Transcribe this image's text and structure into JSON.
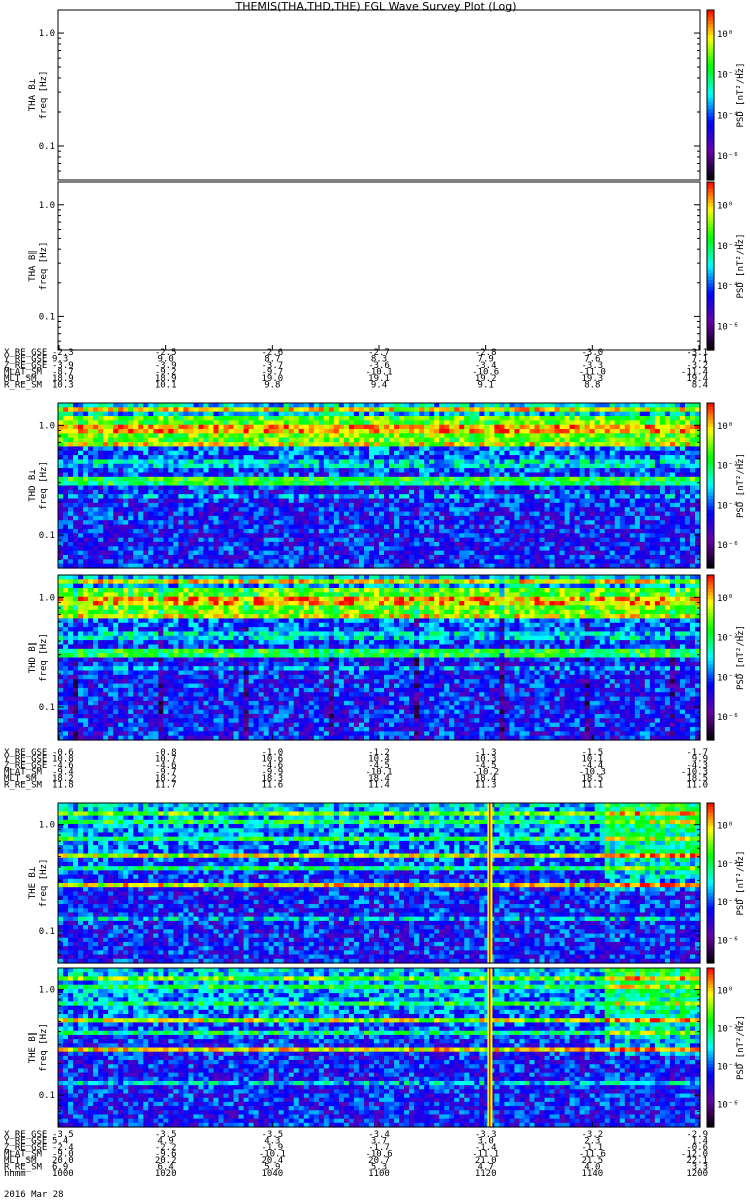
{
  "title": "THEMIS(THA,THD,THE) FGL Wave Survey Plot (Log)",
  "date_label": "2016 Mar 28",
  "chart_data": {
    "type": "heatmap",
    "yscale": "log",
    "ylim": [
      0.05,
      1.6
    ],
    "ytick_labels": [
      "1.0",
      "0.1"
    ],
    "ylabel_unit": "freq [Hz]",
    "colorbar_label": "PSD [nT²/Hz]",
    "colorbar_ticks": [
      "10⁰",
      "10⁻²",
      "10⁻⁴",
      "10⁻⁶"
    ],
    "colorscale": [
      "#000000",
      "#6a00a8",
      "#0000ff",
      "#00ffff",
      "#00ff00",
      "#ffff00",
      "#ff0000"
    ],
    "groups": [
      {
        "panels": [
          {
            "label": "THA B⊥",
            "data": "none"
          },
          {
            "label": "THA B∥",
            "data": "none"
          }
        ],
        "ephemeris": [
          {
            "name": "X_RE_GSE",
            "values": [
              "-2.3",
              "-2.5",
              "-2.6",
              "-2.7",
              "-2.8",
              "-3.0",
              "-3.1"
            ]
          },
          {
            "name": "Y_RE_GSE",
            "values": [
              "9.3",
              "9.0",
              "8.7",
              "8.3",
              "7.9",
              "7.6",
              "7.1"
            ]
          },
          {
            "name": "Z_RE_GSE",
            "values": [
              "-3.9",
              "-3.9",
              "-3.7",
              "-3.6",
              "-3.4",
              "-3.3",
              "-3.2"
            ]
          },
          {
            "name": "MLAT_SM",
            "values": [
              "-8.7",
              "-9.2",
              "-9.7",
              "-10.1",
              "-10.6",
              "-11.0",
              "-11.4"
            ]
          },
          {
            "name": "MLT_SM",
            "values": [
              "18.9",
              "18.9",
              "19.0",
              "19.1",
              "19.2",
              "19.3",
              "19.4"
            ]
          },
          {
            "name": "R_RE_SM",
            "values": [
              "10.3",
              "10.1",
              "9.8",
              "9.4",
              "9.1",
              "8.8",
              "8.4"
            ]
          }
        ]
      },
      {
        "panels": [
          {
            "label": "THD B⊥",
            "data": "spectrogram"
          },
          {
            "label": "THD B∥",
            "data": "spectrogram"
          }
        ],
        "ephemeris": [
          {
            "name": "X_RE_GSE",
            "values": [
              "-0.6",
              "-0.8",
              "-1.0",
              "-1.2",
              "-1.3",
              "-1.5",
              "-1.7"
            ]
          },
          {
            "name": "Y_RE_GSE",
            "values": [
              "10.8",
              "10.7",
              "10.6",
              "10.4",
              "10.3",
              "10.1",
              "9.9"
            ]
          },
          {
            "name": "Z_RE_GSE",
            "values": [
              "-4.6",
              "-4.6",
              "-4.6",
              "-4.5",
              "-4.5",
              "-4.4",
              "-4.3"
            ]
          },
          {
            "name": "MLAT_SM",
            "values": [
              "-9.4",
              "-9.7",
              "-9.9",
              "-10.1",
              "-10.2",
              "-10.3",
              "-10.3"
            ]
          },
          {
            "name": "MLT_SM",
            "values": [
              "18.2",
              "18.2",
              "18.3",
              "18.4",
              "18.4",
              "18.5",
              "18.5"
            ]
          },
          {
            "name": "R_RE_SM",
            "values": [
              "11.8",
              "11.7",
              "11.6",
              "11.4",
              "11.3",
              "11.1",
              "11.0"
            ]
          }
        ]
      },
      {
        "panels": [
          {
            "label": "THE B⊥",
            "data": "spectrogram"
          },
          {
            "label": "THE B∥",
            "data": "spectrogram"
          }
        ],
        "ephemeris": [
          {
            "name": "X_RE_GSE",
            "values": [
              "-3.5",
              "-3.5",
              "-3.5",
              "-3.4",
              "-3.3",
              "-3.2",
              "-2.9"
            ]
          },
          {
            "name": "Y_RE_GSE",
            "values": [
              "5.4",
              "4.9",
              "4.3",
              "3.7",
              "3.0",
              "2.3",
              "1.4"
            ]
          },
          {
            "name": "Z_RE_GSE",
            "values": [
              "-2.4",
              "-2.2",
              "-1.9",
              "-1.7",
              "-1.4",
              "-1.1",
              "-0.6"
            ]
          },
          {
            "name": "MLAT_SM",
            "values": [
              "-9.0",
              "-9.6",
              "-10.1",
              "-10.6",
              "-11.1",
              "-11.6",
              "-12.0"
            ]
          },
          {
            "name": "MLT_SM",
            "values": [
              "20.0",
              "20.2",
              "20.4",
              "20.7",
              "21.0",
              "21.5",
              "22.1"
            ]
          },
          {
            "name": "R_RE_SM",
            "values": [
              "6.9",
              "6.4",
              "5.9",
              "5.3",
              "4.7",
              "4.0",
              "3.3"
            ]
          },
          {
            "name": "hhmm",
            "values": [
              "1000",
              "1020",
              "1040",
              "1100",
              "1120",
              "1140",
              "1200"
            ]
          }
        ]
      }
    ]
  }
}
